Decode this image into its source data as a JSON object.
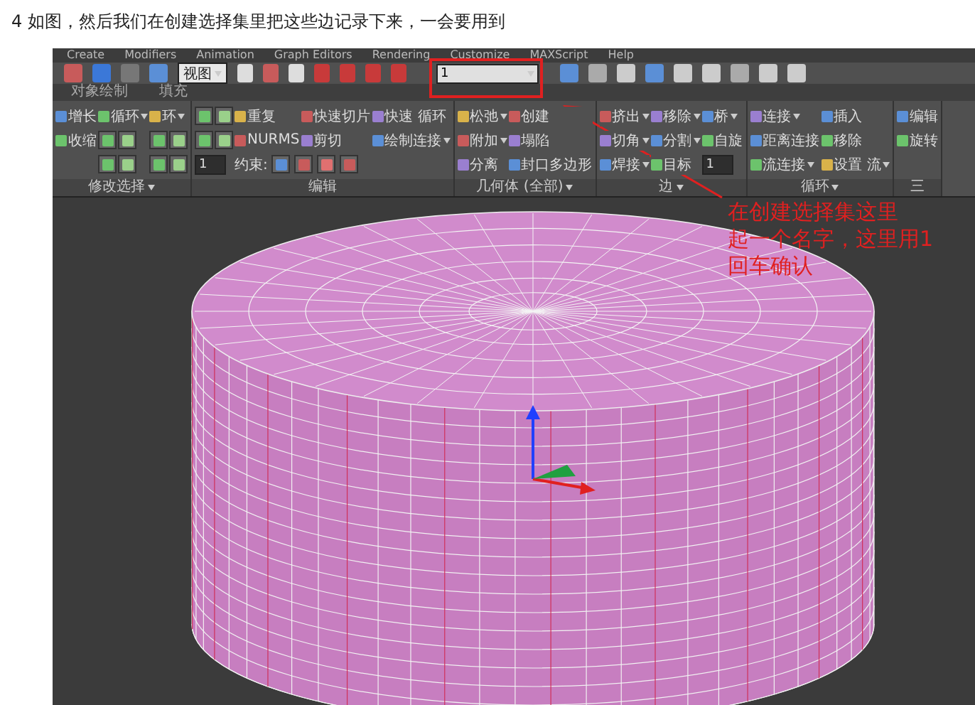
{
  "caption": "4 如图，然后我们在创建选择集里把这些边记录下来，一会要用到",
  "menu": [
    "Create",
    "Modifiers",
    "Animation",
    "Graph Editors",
    "Rendering",
    "Customize",
    "MAXScript",
    "Help"
  ],
  "toolbar": {
    "view_dropdown": "视图",
    "selection_set": {
      "value": "1",
      "highlighted": true
    }
  },
  "ribbon_tabs": [
    {
      "label": "对象绘制",
      "selected": false
    },
    {
      "label": "填充",
      "selected": false
    }
  ],
  "panels": [
    {
      "title": "修改选择",
      "dropdown": true,
      "rows": [
        [
          {
            "kind": "tool",
            "label": "增长",
            "dropdown": false
          },
          {
            "kind": "tool",
            "label": "循环",
            "dropdown": true
          },
          {
            "kind": "tool",
            "label": "环",
            "dropdown": true
          }
        ],
        [
          {
            "kind": "tool",
            "label": "收缩",
            "dropdown": false
          },
          {
            "kind": "icons"
          },
          {
            "kind": "icons"
          }
        ],
        [
          {
            "kind": "gap"
          },
          {
            "kind": "icons"
          },
          {
            "kind": "icons"
          }
        ]
      ]
    },
    {
      "title": "编辑",
      "dropdown": false,
      "rows": [
        [
          {
            "kind": "icons"
          },
          {
            "kind": "tool",
            "label": "重复",
            "dropdown": false
          },
          {
            "kind": "tool",
            "label": "快速切片",
            "dropdown": false
          },
          {
            "kind": "tool",
            "label": "快速 循环",
            "dropdown": false
          }
        ],
        [
          {
            "kind": "icons"
          },
          {
            "kind": "tool",
            "label": "NURMS",
            "dropdown": false
          },
          {
            "kind": "tool",
            "label": "剪切",
            "dropdown": false
          },
          {
            "kind": "tool",
            "label": "绘制连接",
            "dropdown": true
          }
        ],
        [
          {
            "kind": "spinner",
            "value": "1"
          },
          {
            "kind": "constraints",
            "label": "约束:"
          }
        ]
      ]
    },
    {
      "title": "几何体 (全部)",
      "dropdown": true,
      "rows": [
        [
          {
            "kind": "tool",
            "label": "松弛",
            "dropdown": true
          },
          {
            "kind": "tool",
            "label": "创建",
            "dropdown": false
          }
        ],
        [
          {
            "kind": "tool",
            "label": "附加",
            "dropdown": true
          },
          {
            "kind": "tool",
            "label": "塌陷",
            "dropdown": false
          }
        ],
        [
          {
            "kind": "tool",
            "label": "分离",
            "dropdown": false
          },
          {
            "kind": "tool",
            "label": "封口多边形",
            "dropdown": false
          }
        ]
      ]
    },
    {
      "title": "边",
      "dropdown": true,
      "rows": [
        [
          {
            "kind": "tool",
            "label": "挤出",
            "dropdown": true
          },
          {
            "kind": "tool",
            "label": "移除",
            "dropdown": true
          },
          {
            "kind": "tool",
            "label": "桥",
            "dropdown": true
          }
        ],
        [
          {
            "kind": "tool",
            "label": "切角",
            "dropdown": true
          },
          {
            "kind": "tool",
            "label": "分割",
            "dropdown": true
          },
          {
            "kind": "tool",
            "label": "自旋",
            "dropdown": false
          }
        ],
        [
          {
            "kind": "tool",
            "label": "焊接",
            "dropdown": true
          },
          {
            "kind": "tool",
            "label": "目标",
            "dropdown": false
          },
          {
            "kind": "spinner",
            "value": "1"
          }
        ]
      ]
    },
    {
      "title": "循环",
      "dropdown": true,
      "rows": [
        [
          {
            "kind": "tool",
            "label": "连接",
            "dropdown": true
          },
          {
            "kind": "tool",
            "label": "插入",
            "dropdown": false
          }
        ],
        [
          {
            "kind": "tool",
            "label": "距离连接",
            "dropdown": false
          },
          {
            "kind": "tool",
            "label": "移除",
            "dropdown": false
          }
        ],
        [
          {
            "kind": "tool",
            "label": "流连接",
            "dropdown": true
          },
          {
            "kind": "tool",
            "label": "设置 流",
            "dropdown": true
          }
        ]
      ]
    },
    {
      "title": "三",
      "dropdown": false,
      "rows": [
        [
          {
            "kind": "tool",
            "label": "编辑",
            "dropdown": false
          }
        ],
        [
          {
            "kind": "tool",
            "label": "旋转",
            "dropdown": false
          }
        ]
      ]
    }
  ],
  "annotation": {
    "lines": [
      "在创建选择集这里",
      "起一个名字，这里用1",
      "回车确认"
    ]
  }
}
